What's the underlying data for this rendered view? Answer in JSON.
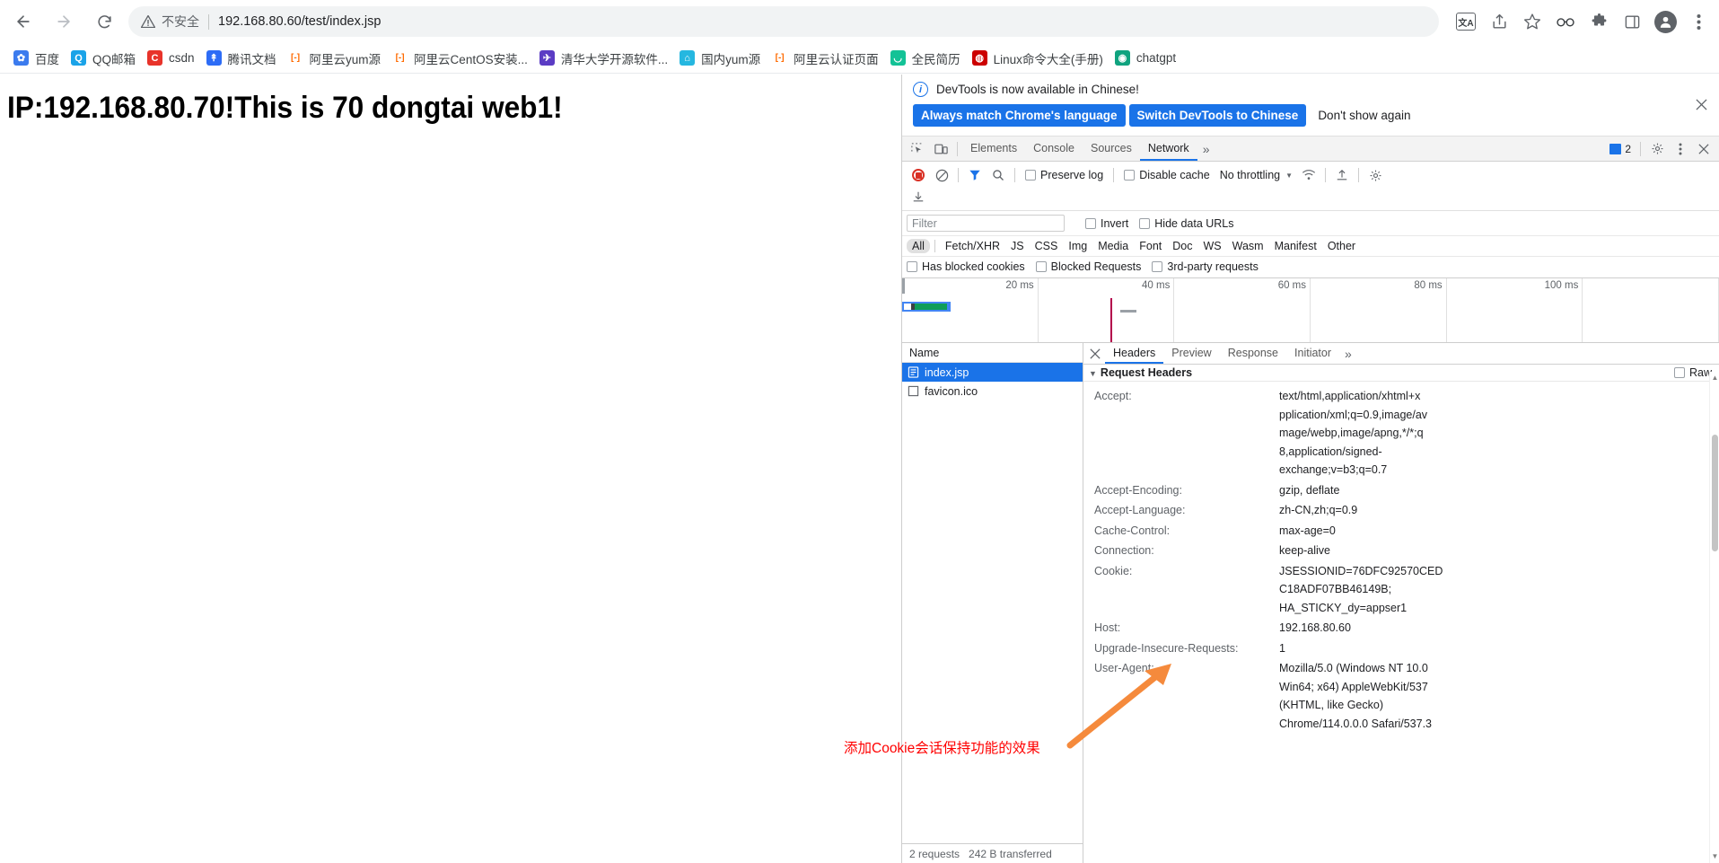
{
  "browser": {
    "back_label": "Back",
    "forward_label": "Forward",
    "reload_label": "Reload",
    "security_label": "不安全",
    "url": "192.168.80.60/test/index.jsp",
    "translate_label": "文A",
    "share_label": "Share",
    "bookmark_label": "Bookmark",
    "extensions_label": "Extensions",
    "sidepanel_label": "Side panel",
    "profile_label": "Profile",
    "menu_label": "Customize and control"
  },
  "bookmarks": [
    {
      "label": "百度",
      "glyph": "✿",
      "color": "#3b7bee"
    },
    {
      "label": "QQ邮箱",
      "glyph": "Q",
      "color": "#1aa3e8"
    },
    {
      "label": "csdn",
      "glyph": "C",
      "color": "#e8332a"
    },
    {
      "label": "腾讯文档",
      "glyph": "↟",
      "color": "#2d6cf6"
    },
    {
      "label": "阿里云yum源",
      "glyph": "[-]",
      "color": "#ff6a00"
    },
    {
      "label": "阿里云CentOS安装...",
      "glyph": "[-]",
      "color": "#ff6a00"
    },
    {
      "label": "清华大学开源软件...",
      "glyph": "✈",
      "color": "#5b3cc4"
    },
    {
      "label": "国内yum源",
      "glyph": "⌂",
      "color": "#25b7e0"
    },
    {
      "label": "阿里云认证页面",
      "glyph": "[-]",
      "color": "#ff6a00"
    },
    {
      "label": "全民简历",
      "glyph": "◡",
      "color": "#13c296"
    },
    {
      "label": "Linux命令大全(手册)",
      "glyph": "◍",
      "color": "#cc0000"
    },
    {
      "label": "chatgpt",
      "glyph": "◉",
      "color": "#10a37f"
    }
  ],
  "page": {
    "heading": "IP:192.168.80.70!This is 70 dongtai web1!"
  },
  "devtools": {
    "banner": {
      "message": "DevTools is now available in Chinese!",
      "primary_button": "Always match Chrome's language",
      "secondary_button": "Switch DevTools to Chinese",
      "dismiss_button": "Don't show again",
      "close_label": "Close"
    },
    "tabs": [
      {
        "label": "Elements",
        "active": false
      },
      {
        "label": "Console",
        "active": false
      },
      {
        "label": "Sources",
        "active": false
      },
      {
        "label": "Network",
        "active": true
      }
    ],
    "tabs_more": "»",
    "issues_count": "2",
    "settings_label": "Settings",
    "more_label": "More options",
    "close_label": "Close DevTools",
    "inspect_label": "Inspect element",
    "device_label": "Toggle device toolbar",
    "toolbar": {
      "record_label": "Stop recording",
      "clear_label": "Clear",
      "filter_label": "Filter",
      "search_label": "Search",
      "preserve_log": "Preserve log",
      "disable_cache": "Disable cache",
      "throttling": "No throttling",
      "network_conditions_label": "Network conditions",
      "import_label": "Import HAR",
      "export_label": "Export HAR",
      "settings_label": "Network settings"
    },
    "filter": {
      "placeholder": "Filter",
      "value": "",
      "invert": "Invert",
      "hide_data_urls": "Hide data URLs"
    },
    "types": [
      "All",
      "Fetch/XHR",
      "JS",
      "CSS",
      "Img",
      "Media",
      "Font",
      "Doc",
      "WS",
      "Wasm",
      "Manifest",
      "Other"
    ],
    "active_type": "All",
    "blocked": [
      "Has blocked cookies",
      "Blocked Requests",
      "3rd-party requests"
    ],
    "overview": {
      "ticks": [
        "20 ms",
        "40 ms",
        "60 ms",
        "80 ms",
        "100 ms"
      ]
    },
    "requests": {
      "column_header": "Name",
      "rows": [
        {
          "name": "index.jsp",
          "selected": true
        },
        {
          "name": "favicon.ico",
          "selected": false
        }
      ],
      "footer": [
        "2 requests",
        "242 B transferred"
      ]
    },
    "detail": {
      "tabs": [
        {
          "label": "Headers",
          "active": true
        },
        {
          "label": "Preview",
          "active": false
        },
        {
          "label": "Response",
          "active": false
        },
        {
          "label": "Initiator",
          "active": false
        }
      ],
      "tabs_more": "»",
      "close_label": "Close",
      "section_title": "Request Headers",
      "raw_label": "Raw",
      "headers": [
        {
          "name": "Accept:",
          "value": "text/html,application/xhtml+x\npplication/xml;q=0.9,image/av\nmage/webp,image/apng,*/*;q\n8,application/signed-\nexchange;v=b3;q=0.7"
        },
        {
          "name": "Accept-Encoding:",
          "value": "gzip, deflate"
        },
        {
          "name": "Accept-Language:",
          "value": "zh-CN,zh;q=0.9"
        },
        {
          "name": "Cache-Control:",
          "value": "max-age=0"
        },
        {
          "name": "Connection:",
          "value": "keep-alive"
        },
        {
          "name": "Cookie:",
          "value": "JSESSIONID=76DFC92570CED\nC18ADF07BB46149B;\nHA_STICKY_dy=appser1"
        },
        {
          "name": "Host:",
          "value": "192.168.80.60"
        },
        {
          "name": "Upgrade-Insecure-Requests:",
          "value": "1"
        },
        {
          "name": "User-Agent:",
          "value": "Mozilla/5.0 (Windows NT 10.0\nWin64; x64) AppleWebKit/537\n(KHTML, like Gecko)\nChrome/114.0.0.0 Safari/537.3"
        }
      ]
    }
  },
  "annotation": {
    "text": "添加Cookie会话保持功能的效果",
    "color": "#ff0000",
    "arrow_color": "#f58a3c"
  }
}
